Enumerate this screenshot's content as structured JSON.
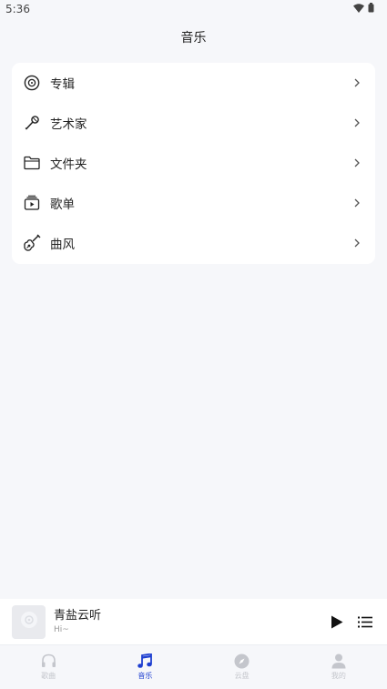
{
  "status_bar": {
    "time": "5:36",
    "wifi_icon": "wifi-icon",
    "battery_icon": "battery-icon"
  },
  "header": {
    "title": "音乐"
  },
  "menu": {
    "items": [
      {
        "label": "专辑",
        "icon": "album-disc-icon"
      },
      {
        "label": "艺术家",
        "icon": "microphone-icon"
      },
      {
        "label": "文件夹",
        "icon": "folder-icon"
      },
      {
        "label": "歌单",
        "icon": "playlist-icon"
      },
      {
        "label": "曲风",
        "icon": "guitar-icon"
      }
    ],
    "chevron_icon": "chevron-right-icon"
  },
  "player": {
    "title": "青盐云听",
    "subtitle": "Hi~",
    "cover_icon": "disc-placeholder-icon",
    "play_icon": "play-icon",
    "queue_icon": "queue-list-icon"
  },
  "tabs": [
    {
      "label": "歌曲",
      "icon": "headphones-icon",
      "active": false
    },
    {
      "label": "音乐",
      "icon": "music-note-icon",
      "active": true
    },
    {
      "label": "云盘",
      "icon": "compass-icon",
      "active": false
    },
    {
      "label": "我的",
      "icon": "person-icon",
      "active": false
    }
  ],
  "colors": {
    "accent": "#1e3fd0",
    "inactive_tab": "#c4c6cc",
    "background": "#f6f7fa",
    "card": "#ffffff"
  }
}
